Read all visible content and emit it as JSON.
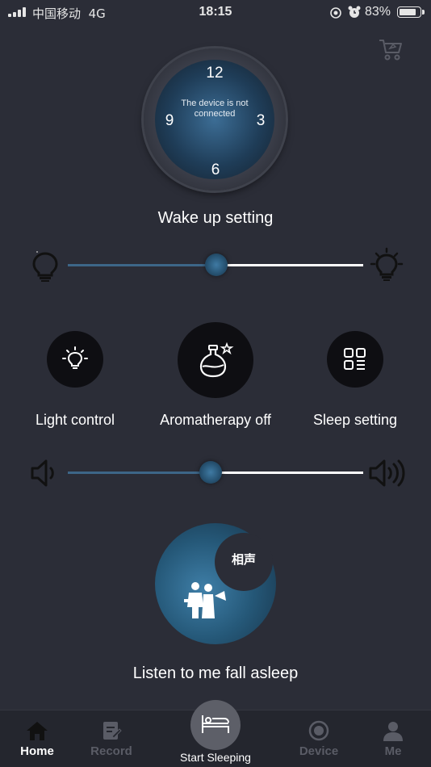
{
  "status_bar": {
    "carrier": "中国移动",
    "network": "4G",
    "time": "18:15",
    "battery": "83%"
  },
  "header": {
    "cart_icon": "cart-icon"
  },
  "clock": {
    "n12": "12",
    "n3": "3",
    "n6": "6",
    "n9": "9",
    "message": "The device is not connected"
  },
  "wake_setting": {
    "label": "Wake up setting",
    "brightness_level": 0.5
  },
  "controls": {
    "light": {
      "label": "Light control",
      "icon": "lightbulb-icon"
    },
    "aroma": {
      "label": "Aromatherapy off",
      "icon": "aroma-bottle-icon"
    },
    "sleep": {
      "label": "Sleep setting",
      "icon": "grid-icon"
    }
  },
  "volume": {
    "level": 0.48
  },
  "story": {
    "badge": "相声",
    "label": "Listen to me fall asleep"
  },
  "tabbar": {
    "home": "Home",
    "record": "Record",
    "start": "Start Sleeping",
    "device": "Device",
    "me": "Me"
  },
  "colors": {
    "background": "#2b2d37",
    "accent": "#3d6688"
  }
}
